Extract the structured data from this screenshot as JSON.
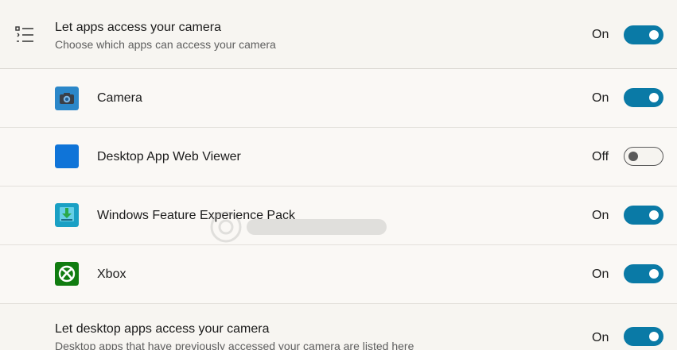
{
  "header": {
    "title": "Let apps access your camera",
    "subtitle": "Choose which apps can access your camera",
    "state": "On",
    "enabled": true
  },
  "apps": [
    {
      "name": "Camera",
      "state": "On",
      "enabled": true,
      "icon": "camera-app-icon"
    },
    {
      "name": "Desktop App Web Viewer",
      "state": "Off",
      "enabled": false,
      "icon": "desktop-app-web-viewer-icon"
    },
    {
      "name": "Windows Feature Experience Pack",
      "state": "On",
      "enabled": true,
      "icon": "windows-feature-experience-pack-icon"
    },
    {
      "name": "Xbox",
      "state": "On",
      "enabled": true,
      "icon": "xbox-icon"
    }
  ],
  "desktop": {
    "title": "Let desktop apps access your camera",
    "subtitle": "Desktop apps that have previously accessed your camera are listed here",
    "state": "On",
    "enabled": true
  },
  "colors": {
    "accent": "#0a7aa6",
    "background": "#f6f4f0"
  }
}
